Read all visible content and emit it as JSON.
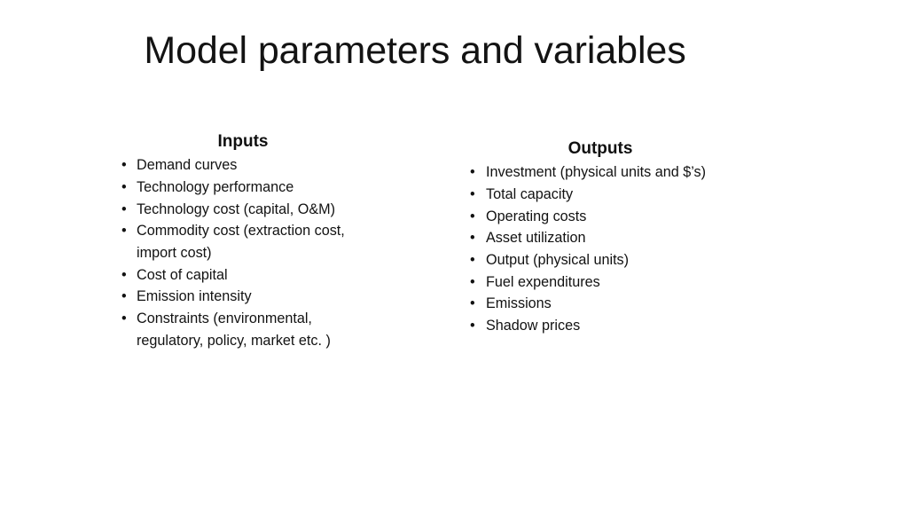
{
  "slide": {
    "title": "Model parameters and variables",
    "background_color": "#ffffff",
    "text_color": "#121212"
  },
  "columns": [
    {
      "id": "inputs",
      "heading": "Inputs",
      "bullet_glyph": "•",
      "items": [
        "Demand curves",
        "Technology performance",
        "Technology cost (capital, O&M)",
        "Commodity cost (extraction cost, import cost)",
        "Cost of capital",
        "Emission intensity",
        "Constraints (environmental, regulatory, policy, market etc. )"
      ]
    },
    {
      "id": "outputs",
      "heading": "Outputs",
      "bullet_glyph": "•",
      "items": [
        "Investment (physical units and $’s)",
        "Total capacity",
        "Operating costs",
        "Asset utilization",
        "Output (physical units)",
        "Fuel expenditures",
        "Emissions",
        "Shadow prices"
      ]
    }
  ]
}
